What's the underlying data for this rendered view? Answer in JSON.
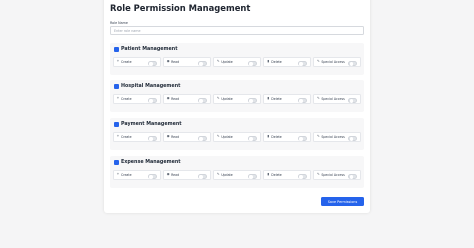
{
  "page": {
    "title": "Role Permission Management",
    "role_label": "Role Name",
    "role_placeholder": "Enter role name",
    "role_value": "",
    "save_label": "Save Permissions"
  },
  "colors": {
    "accent": "#2563eb",
    "toggle_off": "#e1e4e8"
  },
  "sections": [
    {
      "title": "Patient Management",
      "icon": "person-icon",
      "permissions": [
        {
          "label": "Create",
          "icon": "plus-icon",
          "enabled": false
        },
        {
          "label": "Read",
          "icon": "eye-icon",
          "enabled": false
        },
        {
          "label": "Update",
          "icon": "pencil-icon",
          "enabled": false
        },
        {
          "label": "Delete",
          "icon": "trash-icon",
          "enabled": false
        },
        {
          "label": "Special Access",
          "icon": "key-icon",
          "enabled": false
        }
      ]
    },
    {
      "title": "Hospital Management",
      "icon": "hospital-icon",
      "permissions": [
        {
          "label": "Create",
          "icon": "plus-icon",
          "enabled": false
        },
        {
          "label": "Read",
          "icon": "eye-icon",
          "enabled": false
        },
        {
          "label": "Update",
          "icon": "pencil-icon",
          "enabled": false
        },
        {
          "label": "Delete",
          "icon": "trash-icon",
          "enabled": false
        },
        {
          "label": "Special Access",
          "icon": "key-icon",
          "enabled": false
        }
      ]
    },
    {
      "title": "Payment Management",
      "icon": "money-icon",
      "permissions": [
        {
          "label": "Create",
          "icon": "plus-icon",
          "enabled": false
        },
        {
          "label": "Read",
          "icon": "eye-icon",
          "enabled": false
        },
        {
          "label": "Update",
          "icon": "pencil-icon",
          "enabled": false
        },
        {
          "label": "Delete",
          "icon": "trash-icon",
          "enabled": false
        },
        {
          "label": "Special Access",
          "icon": "key-icon",
          "enabled": false
        }
      ]
    },
    {
      "title": "Expense Management",
      "icon": "receipt-icon",
      "permissions": [
        {
          "label": "Create",
          "icon": "plus-icon",
          "enabled": false
        },
        {
          "label": "Read",
          "icon": "eye-icon",
          "enabled": false
        },
        {
          "label": "Update",
          "icon": "pencil-icon",
          "enabled": false
        },
        {
          "label": "Delete",
          "icon": "trash-icon",
          "enabled": false
        },
        {
          "label": "Special Access",
          "icon": "key-icon",
          "enabled": false
        }
      ]
    }
  ]
}
